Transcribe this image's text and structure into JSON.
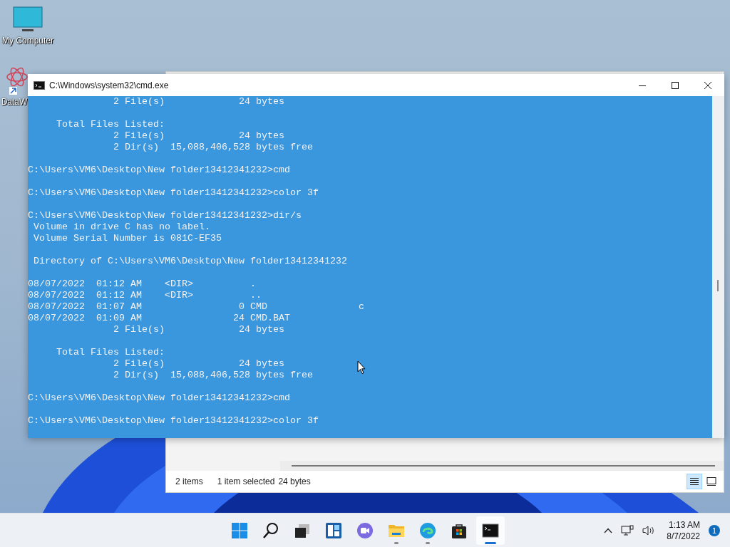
{
  "desktop": {
    "icons": [
      {
        "kind": "monitor",
        "label": "My Computer"
      },
      {
        "kind": "shortcut",
        "label": "DataW"
      }
    ]
  },
  "explorer": {
    "status_bar": {
      "item_count": "2 items",
      "selection": "1 item selected",
      "size": "24 bytes"
    },
    "view_buttons": [
      {
        "kind": "details",
        "selected": true
      },
      {
        "kind": "preview",
        "selected": false
      }
    ]
  },
  "console_window": {
    "title": "C:\\Windows\\system32\\cmd.exe",
    "blocks": [
      [
        "               2 File(s)             24 bytes"
      ],
      [
        "     Total Files Listed:",
        "               2 File(s)             24 bytes",
        "               2 Dir(s)  15,088,406,528 bytes free"
      ],
      [
        "C:\\Users\\VM6\\Desktop\\New folder13412341232>cmd"
      ],
      [
        "C:\\Users\\VM6\\Desktop\\New folder13412341232>color 3f"
      ],
      [
        "C:\\Users\\VM6\\Desktop\\New folder13412341232>dir/s",
        " Volume in drive C has no label.",
        " Volume Serial Number is 081C-EF35"
      ],
      [
        " Directory of C:\\Users\\VM6\\Desktop\\New folder13412341232"
      ],
      [
        "08/07/2022  01:12 AM    <DIR>          .",
        "08/07/2022  01:12 AM    <DIR>          ..",
        "08/07/2022  01:07 AM                 0 CMD                c",
        "08/07/2022  01:09 AM                24 CMD.BAT",
        "               2 File(s)             24 bytes"
      ],
      [
        "     Total Files Listed:",
        "               2 File(s)             24 bytes",
        "               2 Dir(s)  15,088,406,528 bytes free"
      ],
      [
        "C:\\Users\\VM6\\Desktop\\New folder13412341232>cmd"
      ],
      [
        "C:\\Users\\VM6\\Desktop\\New folder13412341232>color 3f"
      ]
    ]
  },
  "taskbar": {
    "apps": [
      {
        "kind": "start",
        "running": false,
        "active": false
      },
      {
        "kind": "search",
        "running": false,
        "active": false
      },
      {
        "kind": "task-view",
        "running": false,
        "active": false
      },
      {
        "kind": "widgets",
        "running": false,
        "active": false
      },
      {
        "kind": "chat",
        "running": false,
        "active": false
      },
      {
        "kind": "folder",
        "running": true,
        "active": false
      },
      {
        "kind": "browser",
        "running": true,
        "active": false
      },
      {
        "kind": "store",
        "running": false,
        "active": false
      },
      {
        "kind": "terminal",
        "running": true,
        "active": true
      }
    ],
    "clock": {
      "time": "1:13 AM",
      "date": "8/7/2022"
    },
    "notification_count": "1"
  }
}
